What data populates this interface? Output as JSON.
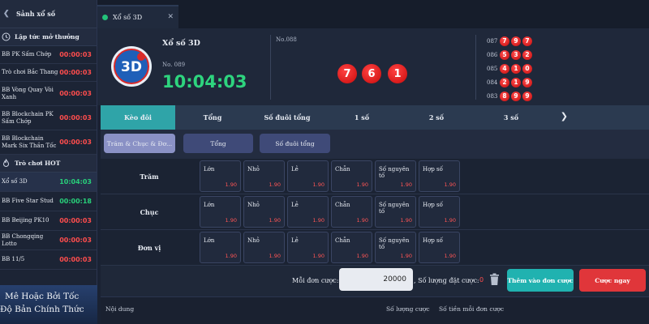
{
  "sidebar": {
    "header": "Sảnh xổ số",
    "section1": "Lập tức mở thưởng",
    "items1": [
      {
        "name": "BB PK Sấm Chớp",
        "time": "00:00:03"
      },
      {
        "name": "Trò chơi Bắc Thang",
        "time": "00:00:03"
      },
      {
        "name": "BB Vòng Quay Vòi Xanh",
        "time": "00:00:03"
      },
      {
        "name": "BB Blockchain PK Sấm Chớp",
        "time": "00:00:03"
      },
      {
        "name": "BB Blockchain Mark Six Thần Tốc",
        "time": "00:00:03"
      }
    ],
    "section2": "Trò chơi HOT",
    "items2": [
      {
        "name": "Xổ số 3D",
        "time": "10:04:03"
      },
      {
        "name": "BB Five Star Stud",
        "time": "00:00:18"
      },
      {
        "name": "BB Beijing PK10",
        "time": "00:00:03"
      },
      {
        "name": "BB Chongqing Lotto",
        "time": "00:00:03"
      },
      {
        "name": "BB 11/5",
        "time": "00:00:03"
      }
    ],
    "banner": {
      "line1": "Mê Hoặc Bởi Tốc",
      "line2": "Độ Bản Chính Thức"
    }
  },
  "tab": {
    "label": "Xổ số 3D"
  },
  "game": {
    "title": "Xổ số 3D",
    "issue": "No. 089",
    "timer": "10:04:03",
    "logo_text": "3D",
    "result_issue": "No.088",
    "result_balls": [
      "7",
      "6",
      "1"
    ],
    "history": [
      {
        "no": "087",
        "balls": [
          "7",
          "9",
          "7"
        ]
      },
      {
        "no": "086",
        "balls": [
          "5",
          "3",
          "2"
        ]
      },
      {
        "no": "085",
        "balls": [
          "4",
          "1",
          "0"
        ]
      },
      {
        "no": "084",
        "balls": [
          "2",
          "1",
          "9"
        ]
      },
      {
        "no": "083",
        "balls": [
          "8",
          "9",
          "9"
        ]
      }
    ]
  },
  "categories": [
    "Kèo đôi",
    "Tổng",
    "Số đuôi tổng",
    "1 số",
    "2 số",
    "3 số"
  ],
  "subtabs": [
    "Trăm & Chục & Đơ...",
    "Tổng",
    "Số đuôi tổng"
  ],
  "bet_rows": [
    {
      "label": "Trăm"
    },
    {
      "label": "Chục"
    },
    {
      "label": "Đơn vị"
    }
  ],
  "bet_options": [
    {
      "label": "Lớn",
      "odds": "1.90"
    },
    {
      "label": "Nhỏ",
      "odds": "1.90"
    },
    {
      "label": "Lẻ",
      "odds": "1.90"
    },
    {
      "label": "Chẵn",
      "odds": "1.90"
    },
    {
      "label": "Số nguyên tố",
      "odds": "1.90"
    },
    {
      "label": "Hợp số",
      "odds": "1.90"
    }
  ],
  "order": {
    "stake_label": "Mỗi đơn cược:",
    "stake_value": "20000",
    "count_label": ", Số lượng đặt cược:",
    "count_value": "0",
    "add_button": "Thêm vào đơn cược",
    "bet_button": "Cược ngay"
  },
  "table_headers": [
    "Nội dung",
    "Số lượng cược",
    "Số tiền mỗi đơn cược"
  ],
  "colors": {
    "accent": "#2fa4a8",
    "timer": "#2ed47e",
    "danger": "#e0363a",
    "ball": "#d81818"
  }
}
